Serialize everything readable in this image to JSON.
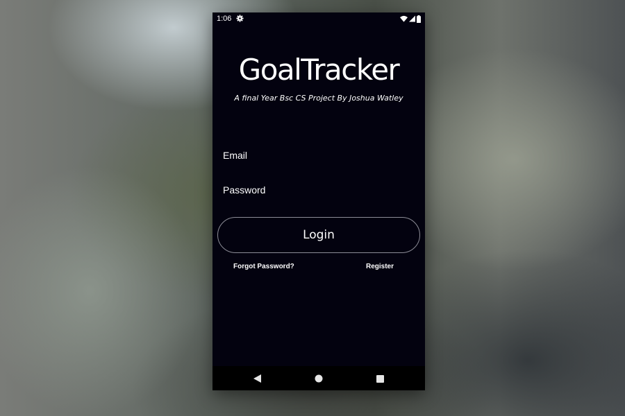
{
  "status_bar": {
    "time": "1:06",
    "icons": [
      "settings-icon",
      "wifi-icon",
      "signal-icon",
      "battery-icon"
    ]
  },
  "app": {
    "title": "GoalTracker",
    "subtitle": "A final Year Bsc CS Project By Joshua Watley"
  },
  "form": {
    "email_placeholder": "Email",
    "email_value": "",
    "password_placeholder": "Password",
    "password_value": "",
    "login_label": "Login"
  },
  "links": {
    "forgot_password": "Forgot Password?",
    "register": "Register"
  },
  "nav_bar": {
    "icons": [
      "back-icon",
      "home-icon",
      "recents-icon"
    ]
  },
  "colors": {
    "screen_background": "#03020f",
    "text": "#ffffff",
    "button_border": "#8d8d97",
    "nav_background": "#000000"
  }
}
